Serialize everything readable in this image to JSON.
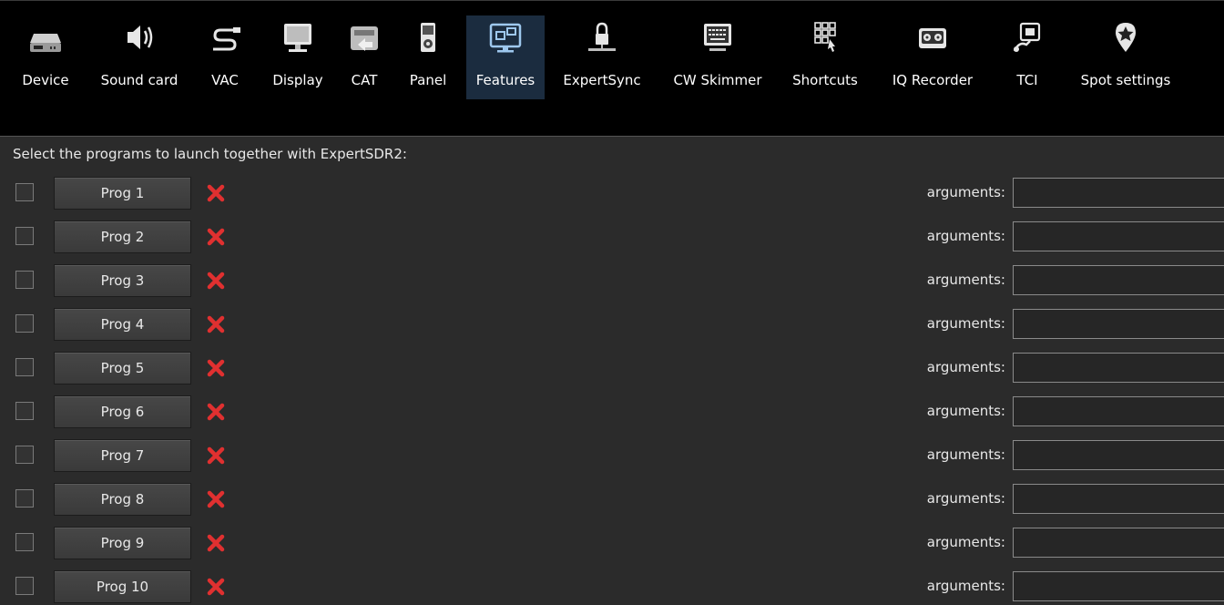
{
  "tabs": [
    {
      "label": "Device",
      "icon": "device-icon"
    },
    {
      "label": "Sound card",
      "icon": "speaker-icon"
    },
    {
      "label": "VAC",
      "icon": "vac-cable-icon"
    },
    {
      "label": "Display",
      "icon": "monitor-icon"
    },
    {
      "label": "CAT",
      "icon": "cat-icon"
    },
    {
      "label": "Panel",
      "icon": "panel-icon"
    },
    {
      "label": "Features",
      "icon": "features-icon",
      "active": true
    },
    {
      "label": "ExpertSync",
      "icon": "lock-icon"
    },
    {
      "label": "CW Skimmer",
      "icon": "keyboard-icon"
    },
    {
      "label": "Shortcuts",
      "icon": "shortcuts-grid-icon"
    },
    {
      "label": "IQ Recorder",
      "icon": "tape-recorder-icon"
    },
    {
      "label": "TCI",
      "icon": "tci-icon"
    },
    {
      "label": "Spot settings",
      "icon": "star-pin-icon"
    }
  ],
  "intro": "Select the programs to launch together with ExpertSDR2:",
  "programs": [
    {
      "label": "Prog 1",
      "args_label": "arguments:",
      "args_value": "",
      "checked": false
    },
    {
      "label": "Prog 2",
      "args_label": "arguments:",
      "args_value": "",
      "checked": false
    },
    {
      "label": "Prog 3",
      "args_label": "arguments:",
      "args_value": "",
      "checked": false
    },
    {
      "label": "Prog 4",
      "args_label": "arguments:",
      "args_value": "",
      "checked": false
    },
    {
      "label": "Prog 5",
      "args_label": "arguments:",
      "args_value": "",
      "checked": false
    },
    {
      "label": "Prog 6",
      "args_label": "arguments:",
      "args_value": "",
      "checked": false
    },
    {
      "label": "Prog 7",
      "args_label": "arguments:",
      "args_value": "",
      "checked": false
    },
    {
      "label": "Prog 8",
      "args_label": "arguments:",
      "args_value": "",
      "checked": false
    },
    {
      "label": "Prog 9",
      "args_label": "arguments:",
      "args_value": "",
      "checked": false
    },
    {
      "label": "Prog 10",
      "args_label": "arguments:",
      "args_value": "",
      "checked": false
    }
  ],
  "colors": {
    "active_tab": "#1b2c3f",
    "delete": "#e03030",
    "background": "#2b2b2b"
  }
}
